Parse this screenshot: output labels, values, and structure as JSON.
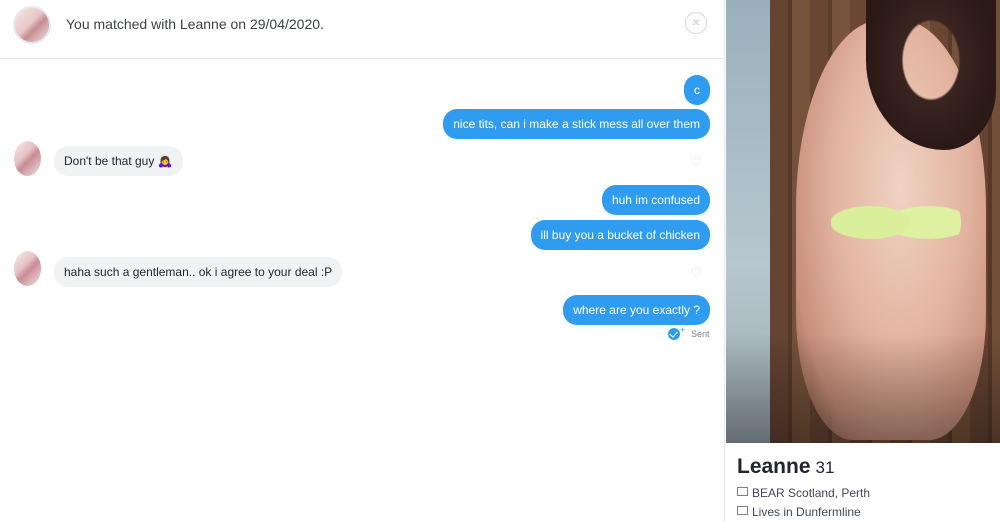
{
  "header": {
    "title": "You matched with Leanne on 29/04/2020.",
    "close_glyph": "×"
  },
  "messages": [
    {
      "dir": "out",
      "text": "c"
    },
    {
      "dir": "out",
      "text": "nice tits, can i make a stick mess all over them"
    },
    {
      "dir": "in",
      "text": "Don't be that guy 🙇‍♀️"
    },
    {
      "dir": "out",
      "text": "huh im confused"
    },
    {
      "dir": "out",
      "text": "ill buy you a bucket of chicken"
    },
    {
      "dir": "in",
      "text": "haha such a gentleman.. ok i agree to your deal :P"
    },
    {
      "dir": "out",
      "text": "where are you exactly ?"
    }
  ],
  "status": {
    "sent_label": "Sent"
  },
  "profile": {
    "name": "Leanne",
    "age": "31",
    "job": "BEAR Scotland, Perth",
    "location": "Lives in Dunfermline"
  },
  "icons": {
    "close": "close-icon",
    "heart": "heart-icon",
    "sent": "sent-check-icon",
    "job": "briefcase-icon",
    "home": "home-icon"
  },
  "colors": {
    "outgoing_bubble": "#2f9cf0",
    "incoming_bubble": "#f0f2f4"
  }
}
